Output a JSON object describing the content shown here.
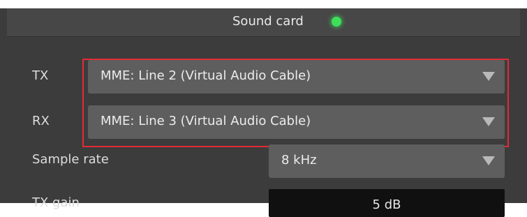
{
  "panel": {
    "title": "Sound card",
    "status_color": "#3ee05a"
  },
  "rows": {
    "tx": {
      "label": "TX",
      "value": "MME: Line 2 (Virtual Audio Cable)"
    },
    "rx": {
      "label": "RX",
      "value": "MME: Line 3 (Virtual Audio Cable)"
    },
    "sample_rate": {
      "label": "Sample rate",
      "value": "8 kHz"
    },
    "tx_gain": {
      "label": "TX gain",
      "value": "5 dB"
    }
  },
  "highlight": {
    "color": "#e32b36"
  },
  "icons": {
    "dropdown_arrow": "triangle-down-icon",
    "status": "status-indicator-icon"
  }
}
